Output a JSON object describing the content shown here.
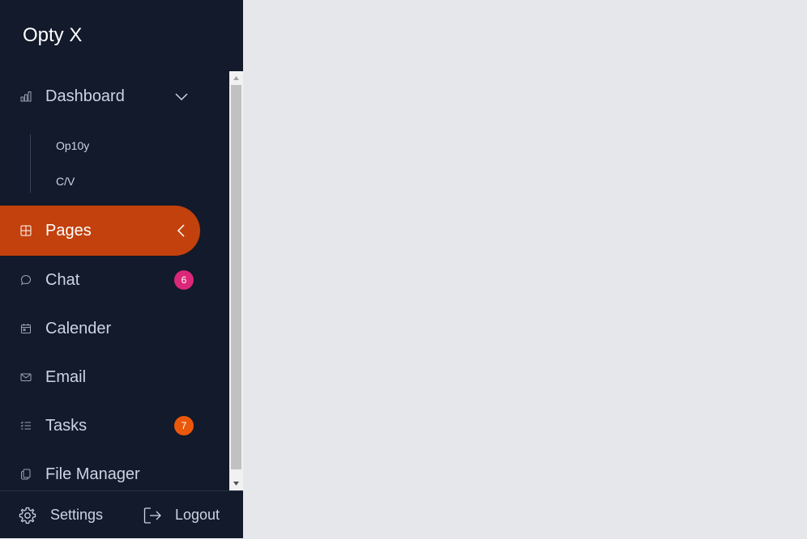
{
  "brand": {
    "title": "Opty X"
  },
  "nav": {
    "dashboard": {
      "label": "Dashboard",
      "icon": "bar-chart-icon",
      "expanded": true
    },
    "sub_items": [
      {
        "label": "Op10y"
      },
      {
        "label": "C/V"
      }
    ],
    "pages": {
      "label": "Pages",
      "icon": "layout-icon",
      "active": true
    },
    "chat": {
      "label": "Chat",
      "icon": "chat-bubble-icon",
      "badge": "6",
      "badge_color": "#db2777"
    },
    "calender": {
      "label": "Calender",
      "icon": "calendar-icon"
    },
    "email": {
      "label": "Email",
      "icon": "mail-icon"
    },
    "tasks": {
      "label": "Tasks",
      "icon": "checklist-icon",
      "badge": "7",
      "badge_color": "#ea580c"
    },
    "file_manager": {
      "label": "File Manager",
      "icon": "file-copy-icon"
    }
  },
  "footer": {
    "settings": {
      "label": "Settings",
      "icon": "gear-icon"
    },
    "logout": {
      "label": "Logout",
      "icon": "logout-icon"
    }
  },
  "colors": {
    "sidebar_bg": "#121a2b",
    "active_bg": "#c2410c",
    "content_bg": "#e5e7eb"
  }
}
